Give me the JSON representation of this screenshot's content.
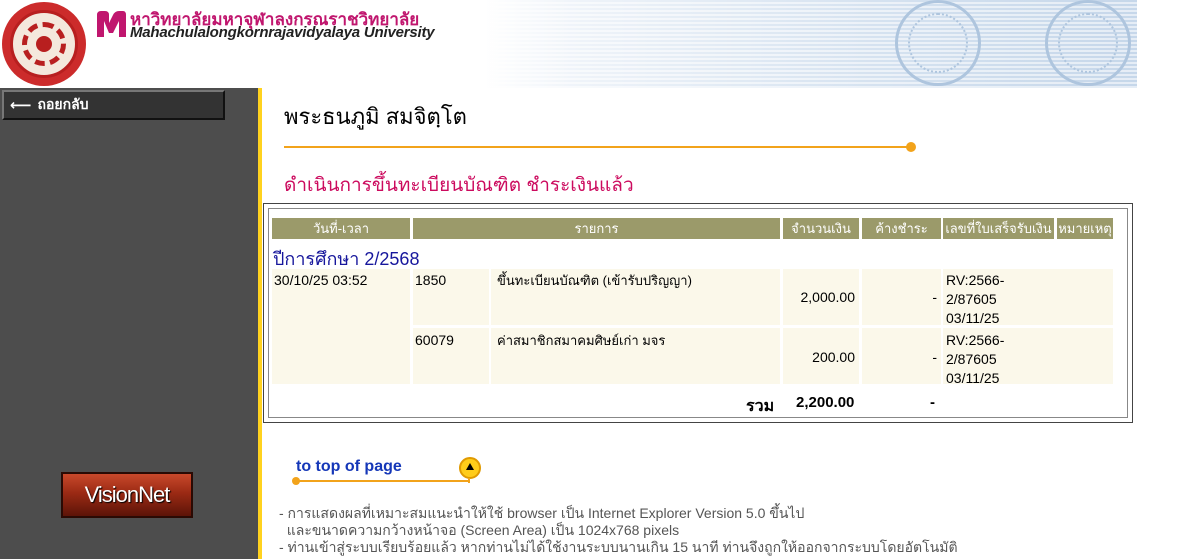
{
  "header": {
    "univ_thai": "หาวิทยาลัยมหาจุฬาลงกรณราชวิทยาลัย",
    "univ_en": "Mahachulalongkornrajavidyalaya University",
    "brand_color": "#c0166e"
  },
  "sidebar": {
    "back_label": "ถอยกลับ",
    "visionnet_label": "VisionNet"
  },
  "main": {
    "student_name": "พระธนภูมิ สมจิตฺโต",
    "status_text": "ดำเนินการขึ้นทะเบียนบัณฑิต ชำระเงินแล้ว",
    "status_color": "#cc0a5e",
    "table": {
      "headers": [
        "วันที่-เวลา",
        "รายการ",
        "จำนวนเงิน",
        "ค้างชำระ",
        "เลขที่ใบเสร็จรับเงิน",
        "หมายเหตุ"
      ],
      "year_label": "ปีการศึกษา 2/2568",
      "rows": [
        {
          "datetime": "30/10/25 03:52",
          "code": "1850",
          "item": "ขึ้นทะเบียนบัณฑิต (เข้ารับปริญญา)",
          "amount": "2,000.00",
          "outstanding": "-",
          "receipt_line1": "RV:2566-",
          "receipt_line2": "2/87605",
          "receipt_line3": "03/11/25",
          "remark": ""
        },
        {
          "datetime": "",
          "code": "60079",
          "item": "ค่าสมาชิกสมาคมศิษย์เก่า มจร",
          "amount": "200.00",
          "outstanding": "-",
          "receipt_line1": "RV:2566-",
          "receipt_line2": "2/87605",
          "receipt_line3": "03/11/25",
          "remark": ""
        }
      ],
      "total_label": "รวม",
      "total_amount": "2,200.00",
      "total_outstanding": "-"
    },
    "to_top_label": "to top of page",
    "notes": [
      "- การแสดงผลที่เหมาะสมแนะนำให้ใช้ browser เป็น Internet Explorer Version 5.0 ขึ้นไป",
      "  และขนาดความกว้างหน้าจอ (Screen Area) เป็น 1024x768 pixels",
      "- ท่านเข้าสู่ระบบเรียบร้อยแล้ว หากท่านไม่ได้ใช้งานระบบนานเกิน 15 นาที ท่านจึงถูกให้ออกจากระบบโดยอัตโนมัติ"
    ]
  }
}
